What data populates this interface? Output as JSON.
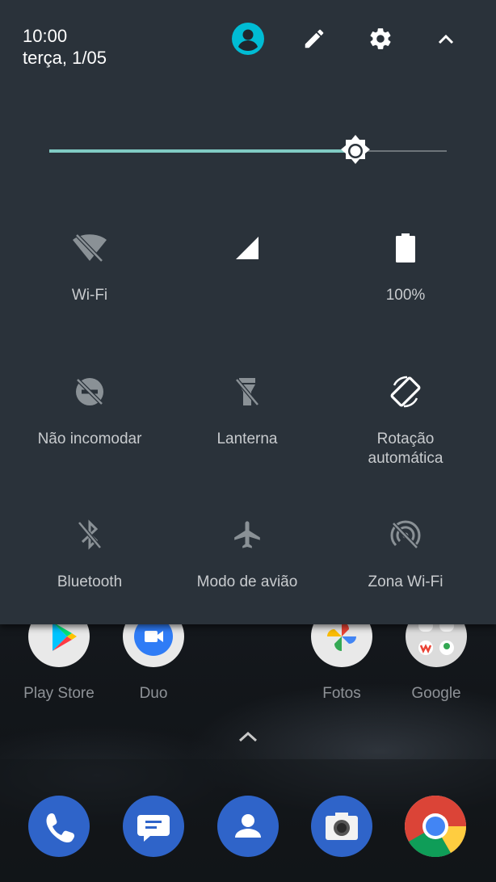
{
  "status": {
    "time": "10:00",
    "date": "terça, 1/05"
  },
  "brightness": {
    "level": 0.77
  },
  "tiles": [
    {
      "icon": "wifi-off-icon",
      "label": "Wi-Fi",
      "active": false
    },
    {
      "icon": "cellular-signal-icon",
      "label": "",
      "active": true
    },
    {
      "icon": "battery-icon",
      "label": "100%",
      "active": true
    },
    {
      "icon": "do-not-disturb-off-icon",
      "label": "Não incomodar",
      "active": false
    },
    {
      "icon": "flashlight-off-icon",
      "label": "Lanterna",
      "active": false
    },
    {
      "icon": "auto-rotate-icon",
      "label": "Rotação automática",
      "active": true
    },
    {
      "icon": "bluetooth-off-icon",
      "label": "Bluetooth",
      "active": false
    },
    {
      "icon": "airplane-icon",
      "label": "Modo de avião",
      "active": false
    },
    {
      "icon": "hotspot-off-icon",
      "label": "Zona Wi-Fi",
      "active": false
    }
  ],
  "home_apps": [
    {
      "label": "Play Store",
      "icon": "play-store-icon"
    },
    {
      "label": "Duo",
      "icon": "duo-icon"
    },
    {
      "label": "Fotos",
      "icon": "photos-icon"
    },
    {
      "label": "Google",
      "icon": "google-folder-icon"
    }
  ],
  "dock": [
    {
      "icon": "phone-icon"
    },
    {
      "icon": "messages-icon"
    },
    {
      "icon": "contacts-icon"
    },
    {
      "icon": "camera-icon"
    },
    {
      "icon": "chrome-icon"
    }
  ],
  "colors": {
    "accent": "#00BCD4",
    "slider": "#80CBC4",
    "shade": "#2A323A"
  }
}
